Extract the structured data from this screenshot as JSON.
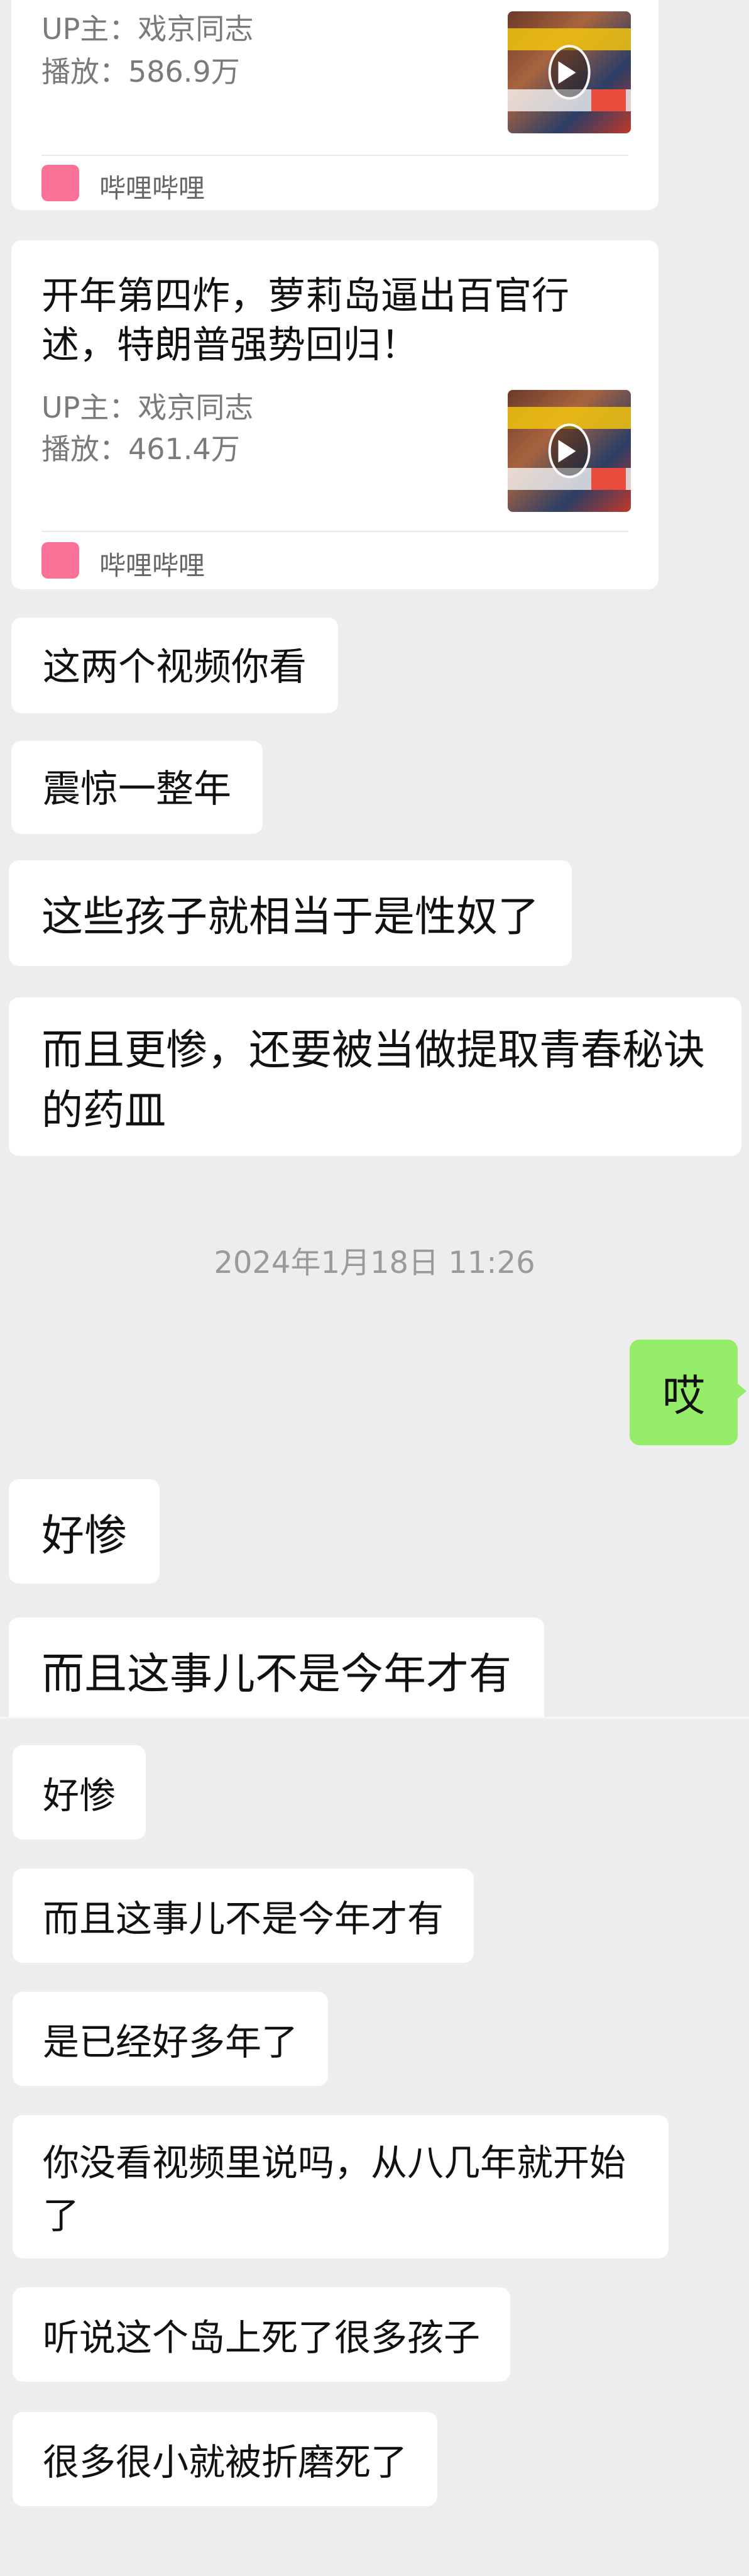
{
  "cards": [
    {
      "title": "",
      "uploader": "UP主：戏京同志",
      "plays": "播放：586.9万",
      "thumb_name": "video-thumbnail",
      "source": "哔哩哔哩"
    },
    {
      "title": "开年第四炸，萝莉岛逼出百官行述，特朗普强势回归！",
      "uploader": "UP主：戏京同志",
      "plays": "播放：461.4万",
      "thumb_name": "video-thumbnail",
      "source": "哔哩哔哩"
    }
  ],
  "top_messages": [
    {
      "side": "left",
      "text": "这两个视频你看"
    },
    {
      "side": "left",
      "text": "震惊一整年"
    },
    {
      "side": "left",
      "text": "这些孩子就相当于是性奴了"
    },
    {
      "side": "left",
      "text": "而且更惨，还要被当做提取青春秘诀的药皿"
    }
  ],
  "timestamp": "2024年1月18日 11:26",
  "my_message": "哎",
  "after_messages": [
    {
      "side": "left",
      "text": "好惨"
    },
    {
      "side": "left",
      "text": "而且这事儿不是今年才有"
    }
  ],
  "second_screenshot_messages": [
    {
      "side": "left",
      "text": "好惨"
    },
    {
      "side": "left",
      "text": "而且这事儿不是今年才有"
    },
    {
      "side": "left",
      "text": "是已经好多年了"
    },
    {
      "side": "left",
      "text": "你没看视频里说吗，从八几年就开始了"
    },
    {
      "side": "left",
      "text": "听说这个岛上死了很多孩子"
    },
    {
      "side": "left",
      "text": "很多很小就被折磨死了"
    }
  ],
  "icons": {
    "bilibili": "bilibili-logo-icon",
    "play": "play-icon"
  },
  "colors": {
    "background": "#ededed",
    "my_bubble": "#95ec69",
    "bilibili_pink": "#fb7299"
  }
}
